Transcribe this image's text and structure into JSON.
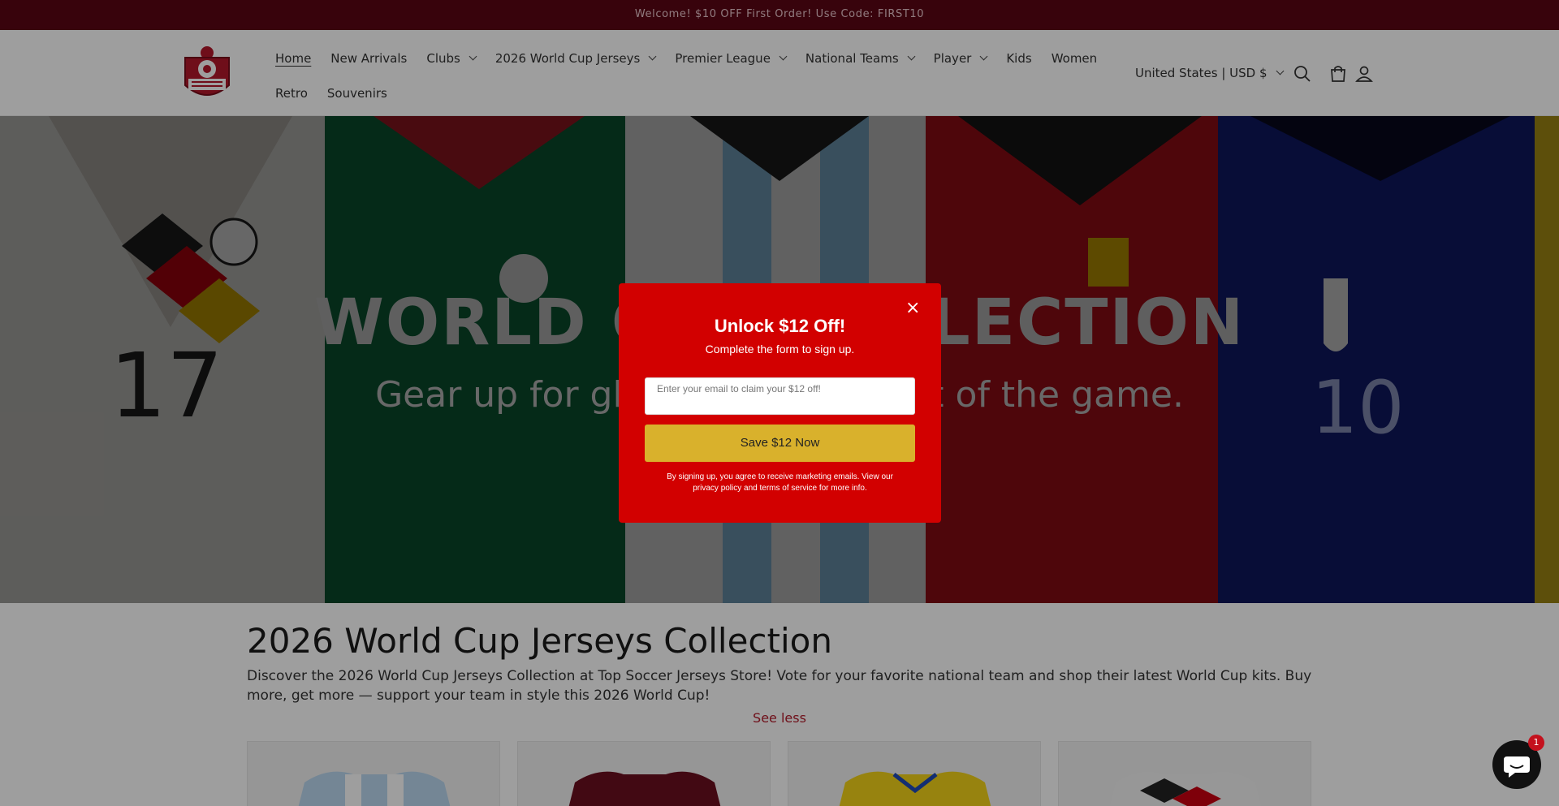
{
  "announcement": "Welcome! $10 OFF First Order! Use Code: FIRST10",
  "logo": {
    "text": "TOP SOCCER JERSEYS STORE"
  },
  "nav": {
    "row1": [
      {
        "label": "Home",
        "active": true,
        "dropdown": false
      },
      {
        "label": "New Arrivals",
        "dropdown": false
      },
      {
        "label": "Clubs",
        "dropdown": true
      },
      {
        "label": "2026 World Cup Jerseys",
        "dropdown": true
      },
      {
        "label": "Premier League",
        "dropdown": true
      },
      {
        "label": "National Teams",
        "dropdown": true
      },
      {
        "label": "Player",
        "dropdown": true
      },
      {
        "label": "Kids",
        "dropdown": false
      },
      {
        "label": "Women",
        "dropdown": false
      }
    ],
    "row2": [
      {
        "label": "Retro",
        "dropdown": false
      },
      {
        "label": "Souvenirs",
        "dropdown": false
      }
    ]
  },
  "country_selector": "United States | USD $",
  "hero": {
    "title": "WORLD CUP COLLECTION",
    "subtitle": "Gear up for glory with the heart of the game."
  },
  "collection": {
    "title": "2026 World Cup Jerseys Collection",
    "description": "Discover the 2026 World Cup Jerseys Collection at Top Soccer Jerseys Store!    Vote for your favorite national team and shop their latest World Cup kits. Buy more, get more — support your team in style this 2026 World Cup!",
    "see_less": "See less"
  },
  "popup": {
    "close": "×",
    "title": "Unlock $12 Off!",
    "subtitle": "Complete the form to sign up.",
    "email_placeholder": " Enter your email to claim your $12 off!",
    "button": " Save $12 Now",
    "legal": "By signing up, you agree to receive marketing emails. View our privacy policy and terms of service for more info."
  },
  "chat_badge": "1",
  "colors": {
    "brand_dark": "#5b0614",
    "popup_red": "#d20000",
    "popup_button": "#d9b12c",
    "link_red": "#b31b2b"
  }
}
